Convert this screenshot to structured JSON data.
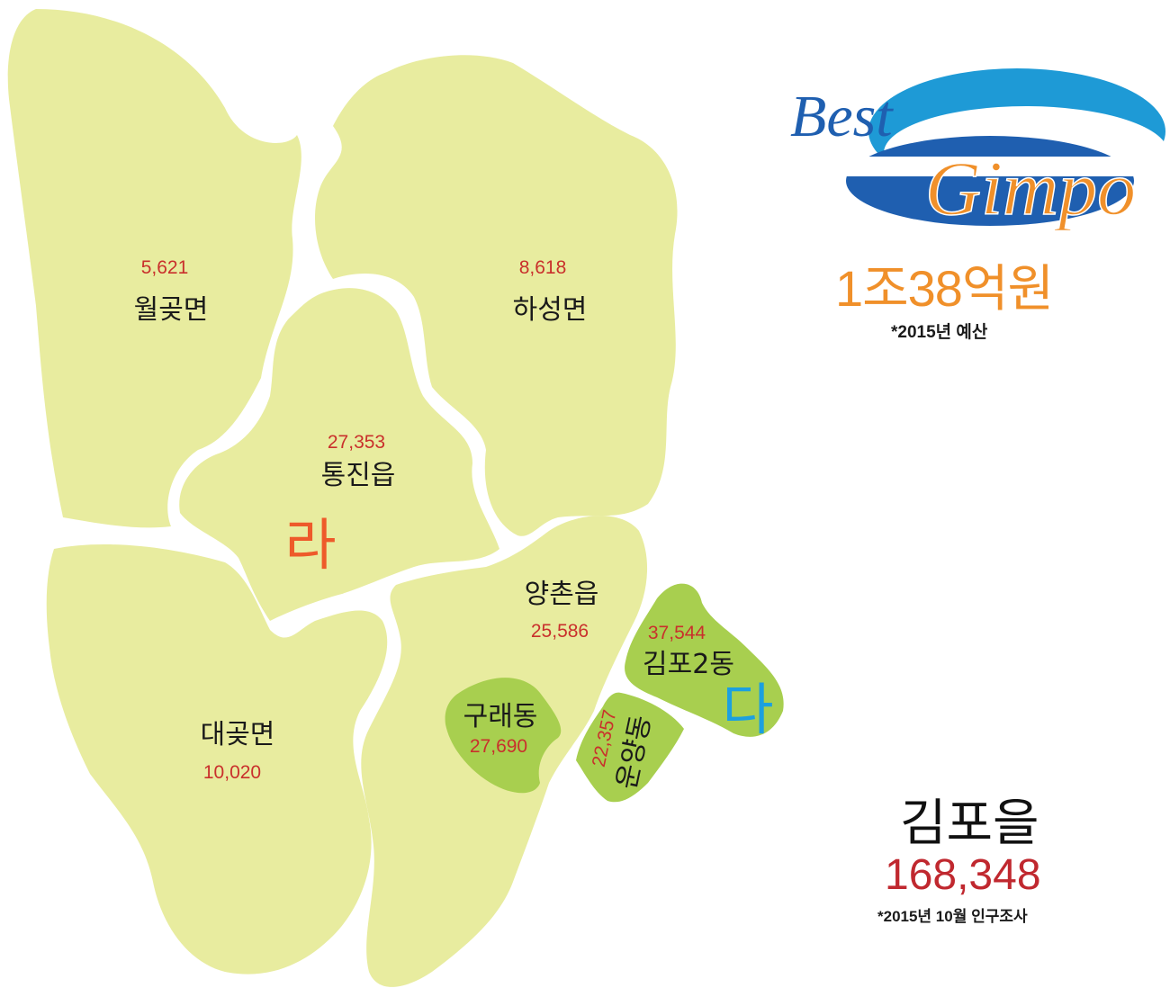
{
  "logo": {
    "word1": "Best",
    "word2": "Gimpo"
  },
  "budget": {
    "amount": "1조38억원",
    "note": "*2015년 예산"
  },
  "district": {
    "name": "김포을",
    "population": "168,348",
    "note": "*2015년 10월 인구조사"
  },
  "district_marks": {
    "ra": "라",
    "da": "다"
  },
  "regions": {
    "wolgot": {
      "name": "월곶면",
      "population": "5,621"
    },
    "haseong": {
      "name": "하성면",
      "population": "8,618"
    },
    "tongjin": {
      "name": "통진읍",
      "population": "27,353"
    },
    "daegot": {
      "name": "대곶면",
      "population": "10,020"
    },
    "yangchon": {
      "name": "양촌읍",
      "population": "25,586"
    },
    "gimpo2": {
      "name": "김포2동",
      "population": "37,544"
    },
    "gurae": {
      "name": "구래동",
      "population": "27,690"
    },
    "unyang": {
      "name": "운양동",
      "population": "22,357"
    }
  },
  "colors": {
    "land_light": "#e8ec9f",
    "land_green": "#a8cf4f",
    "population_red": "#c9302c",
    "district_ra_orange": "#ee5a2a",
    "district_da_blue": "#1ca0df",
    "budget_orange": "#f0902a",
    "logo_blue": "#1f5fb0",
    "logo_orange": "#f0902a"
  }
}
